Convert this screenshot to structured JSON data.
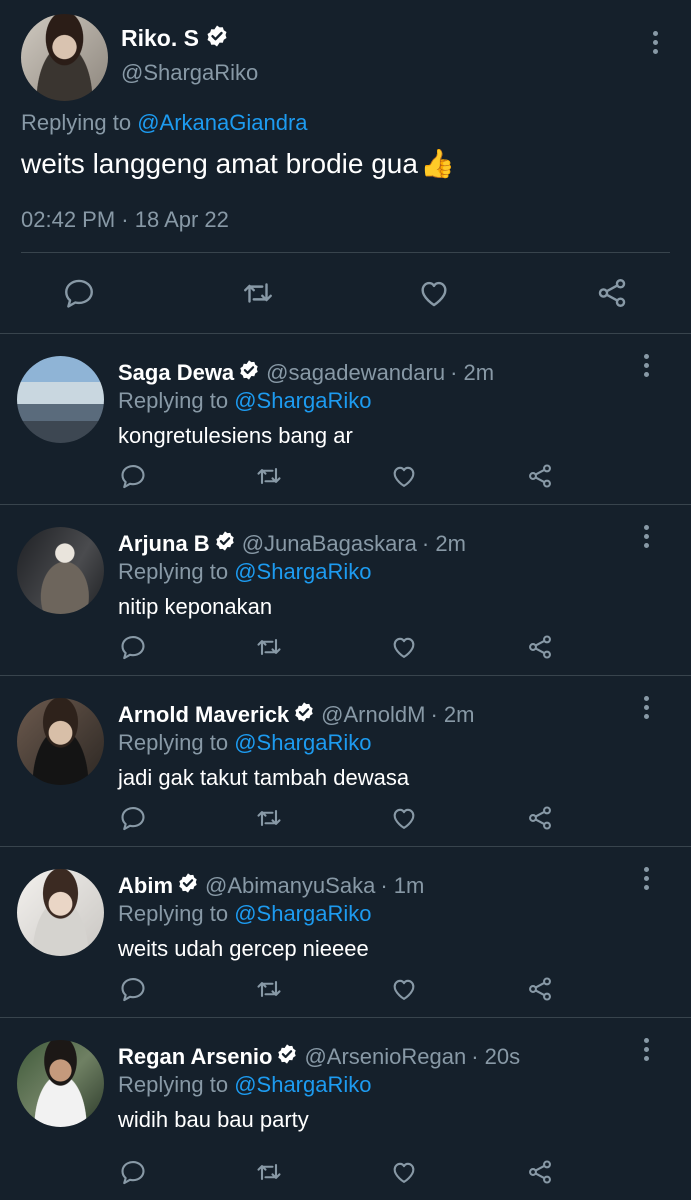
{
  "main_tweet": {
    "name": "Riko. S",
    "handle": "@ShargaRiko",
    "replying_prefix": "Replying to",
    "replying_to": "@ArkanaGiandra",
    "text": "weits langgeng amat brodie gua",
    "emoji": "👍",
    "timestamp": "02:42 PM · 18 Apr 22"
  },
  "icons": {
    "reply": "reply-icon",
    "retweet": "retweet-icon",
    "like": "like-icon",
    "share": "share-icon",
    "verified": "verified-badge-icon",
    "more": "more-options-icon"
  },
  "colors": {
    "background": "#15202b",
    "text": "#ffffff",
    "muted": "#8899a6",
    "link": "#1d9bf0",
    "divider": "#38444d"
  },
  "replies": [
    {
      "name": "Saga Dewa",
      "handle": "@sagadewandaru",
      "time": "· 2m",
      "replying_prefix": "Replying to",
      "replying_to": "@ShargaRiko",
      "text": "kongretulesiens bang ar"
    },
    {
      "name": "Arjuna B",
      "handle": "@JunaBagaskara",
      "time": "· 2m",
      "replying_prefix": "Replying to",
      "replying_to": "@ShargaRiko",
      "text": "nitip keponakan"
    },
    {
      "name": "Arnold Maverick",
      "handle": "@ArnoldM",
      "time": "· 2m",
      "replying_prefix": "Replying to",
      "replying_to": "@ShargaRiko",
      "text": "jadi gak takut tambah dewasa"
    },
    {
      "name": "Abim",
      "handle": "@AbimanyuSaka",
      "time": "· 1m",
      "replying_prefix": "Replying to",
      "replying_to": "@ShargaRiko",
      "text": "weits udah gercep nieeee"
    },
    {
      "name": "Regan Arsenio",
      "handle": "@ArsenioRegan",
      "time": "· 20s",
      "replying_prefix": "Replying to",
      "replying_to": "@ShargaRiko",
      "text": "widih bau bau party"
    }
  ]
}
